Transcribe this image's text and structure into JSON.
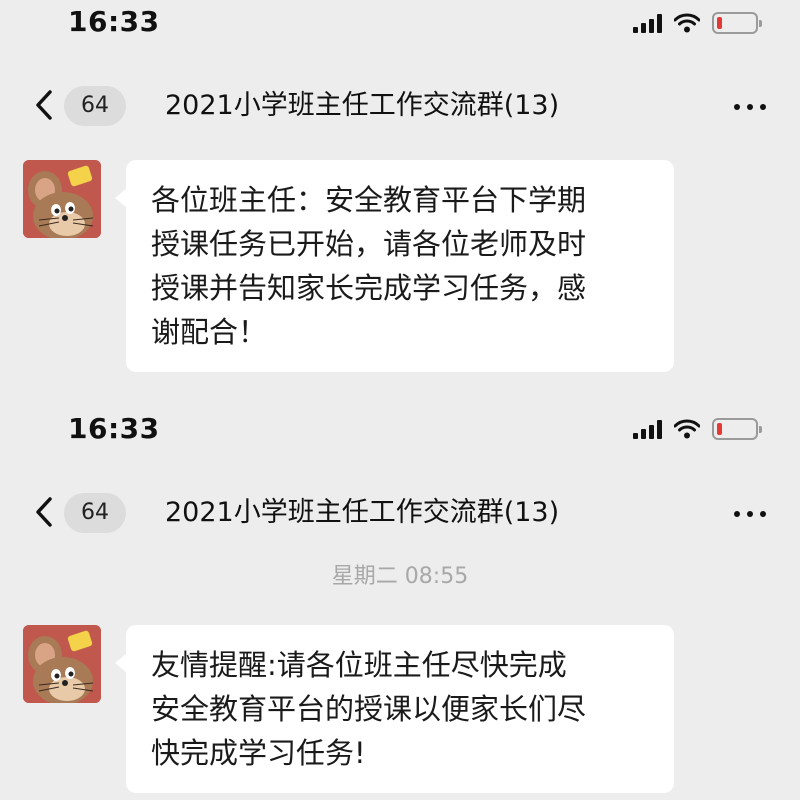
{
  "screens": [
    {
      "status": {
        "time": "16:33"
      },
      "nav": {
        "back_icon": "chevron-left",
        "unread_count": "64",
        "title": "2021小学班主任工作交流群(13)",
        "more_icon": "ellipsis"
      },
      "timestamp": "",
      "message": {
        "avatar_icon": "cartoon-mouse",
        "text": "各位班主任：安全教育平台下学期\n授课任务已开始，请各位老师及时\n授课并告知家长完成学习任务，感\n谢配合！"
      }
    },
    {
      "status": {
        "time": "16:33"
      },
      "nav": {
        "back_icon": "chevron-left",
        "unread_count": "64",
        "title": "2021小学班主任工作交流群(13)",
        "more_icon": "ellipsis"
      },
      "timestamp": "星期二 08:55",
      "message": {
        "avatar_icon": "cartoon-mouse",
        "text": "友情提醒:请各位班主任尽快完成\n安全教育平台的授课以便家长们尽\n快完成学习任务!"
      }
    }
  ],
  "colors": {
    "background": "#ededed",
    "bubble": "#ffffff",
    "avatar_bg": "#c1584d",
    "battery_low": "#e53935",
    "timestamp": "#a8a8a8"
  }
}
